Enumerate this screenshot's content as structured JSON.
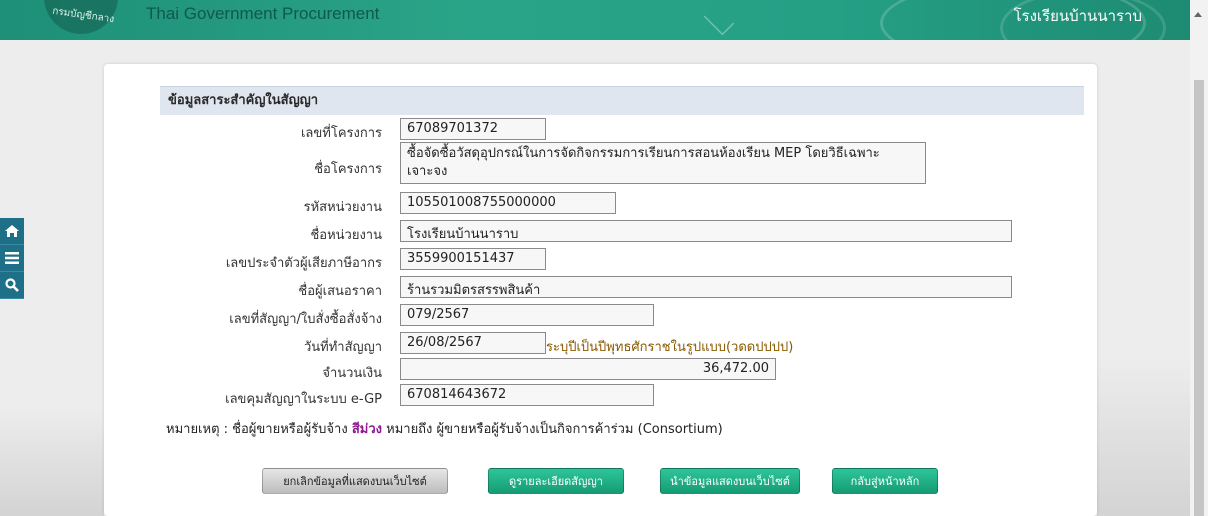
{
  "header": {
    "logo_text": "กรมบัญชีกลาง",
    "title": "Thai Government Procurement",
    "agency": "โรงเรียนบ้านนาราบ"
  },
  "side_tools": {
    "home_icon": "home-icon",
    "menu_icon": "menu-icon",
    "search_icon": "search-icon"
  },
  "section": {
    "title": "ข้อมูลสาระสำคัญในสัญญา"
  },
  "fields": {
    "project_no": {
      "label": "เลขที่โครงการ",
      "value": "67089701372"
    },
    "project_name": {
      "label": "ชื่อโครงการ",
      "value": "ซื้อจัดซื้อวัสดุอุปกรณ์ในการจัดกิจกรรมการเรียนการสอนห้องเรียน MEP โดยวิธีเฉพาะเจาะจง"
    },
    "agency_code": {
      "label": "รหัสหน่วยงาน",
      "value": "105501008755000000"
    },
    "agency_name": {
      "label": "ชื่อหน่วยงาน",
      "value": "โรงเรียนบ้านนาราบ"
    },
    "tax_id": {
      "label": "เลขประจำตัวผู้เสียภาษีอากร",
      "value": "3559900151437"
    },
    "bidder_name": {
      "label": "ชื่อผู้เสนอราคา",
      "value": "ร้านรวมมิตรสรรพสินค้า"
    },
    "contract_no": {
      "label": "เลขที่สัญญา/ใบสั่งซื้อสั่งจ้าง",
      "value": "079/2567"
    },
    "contract_date": {
      "label": "วันที่ทำสัญญา",
      "value": "26/08/2567",
      "hint": "ระบุปีเป็นปีพุทธศักราชในรูปแบบ(วดดปปปป)"
    },
    "amount": {
      "label": "จำนวนเงิน",
      "value": "36,472.00"
    },
    "egp_no": {
      "label": "เลขคุมสัญญาในระบบ e-GP",
      "value": "670814643672"
    }
  },
  "note": {
    "prefix": "หมายเหตุ : ชื่อผู้ขายหรือผู้รับจ้าง",
    "highlight": "สีม่วง",
    "suffix": "หมายถึง ผู้ขายหรือผู้รับจ้างเป็นกิจการค้าร่วม (Consortium)",
    "highlight_color": "#8e1a8e"
  },
  "buttons": {
    "cancel": "ยกเลิกข้อมูลที่แสดงบนเว็บไซต์",
    "view_contract": "ดูรายละเอียดสัญญา",
    "publish": "นำข้อมูลแสดงบนเว็บไซต์",
    "back_home": "กลับสู่หน้าหลัก"
  },
  "colors": {
    "header_green": "#25a085",
    "button_green": "#169c74",
    "section_bg": "#dfe6ef"
  }
}
